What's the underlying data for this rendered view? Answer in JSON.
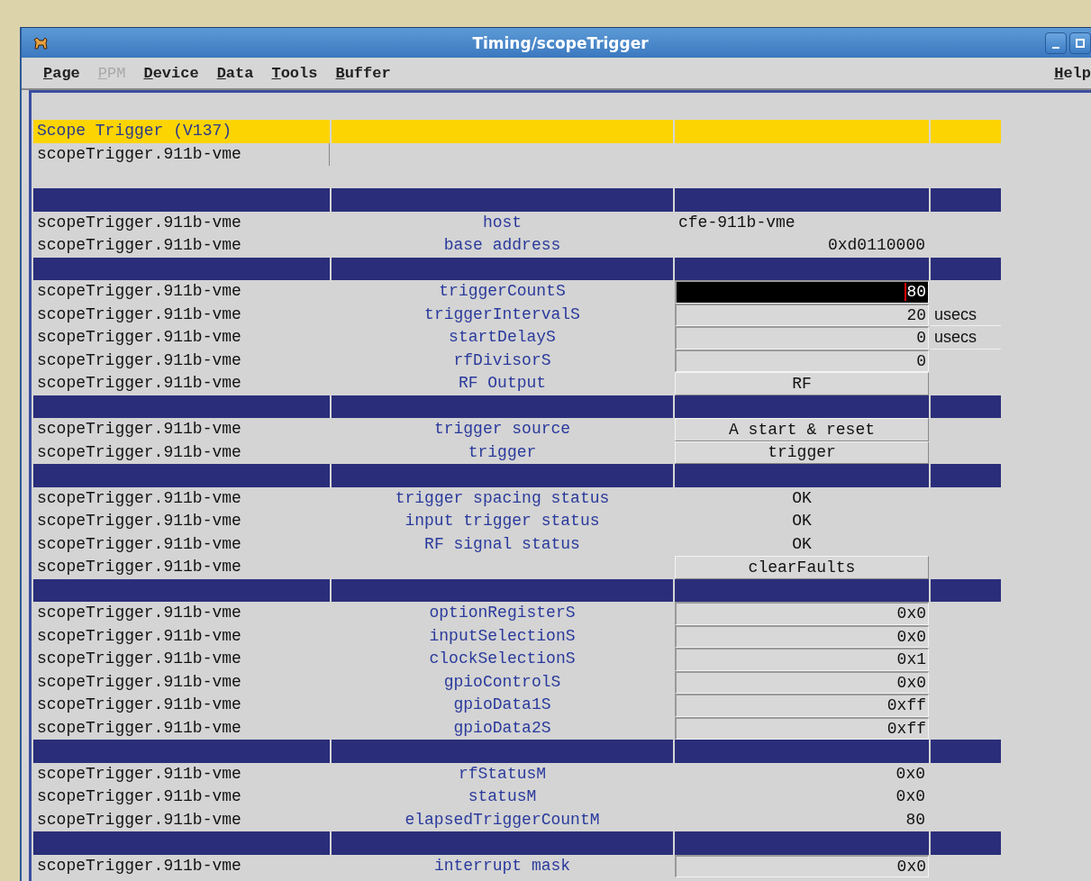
{
  "window": {
    "title": "Timing/scopeTrigger"
  },
  "menu": [
    {
      "label": "Page",
      "disabled": false
    },
    {
      "label": "PPM",
      "disabled": true
    },
    {
      "label": "Device",
      "disabled": false
    },
    {
      "label": "Data",
      "disabled": false
    },
    {
      "label": "Tools",
      "disabled": false
    },
    {
      "label": "Buffer",
      "disabled": false
    }
  ],
  "help_menu": {
    "label": "Help",
    "disabled": false
  },
  "header": {
    "title": "Scope Trigger (V137)",
    "device": "scopeTrigger.911b-vme"
  },
  "sections": [
    {
      "rows": [
        {
          "device": "scopeTrigger.911b-vme",
          "property": "host",
          "kind": "text-left",
          "value": "cfe-911b-vme"
        },
        {
          "device": "scopeTrigger.911b-vme",
          "property": "base address",
          "kind": "text-right",
          "value": "0xd0110000"
        }
      ]
    },
    {
      "rows": [
        {
          "device": "scopeTrigger.911b-vme",
          "property": "triggerCountS",
          "kind": "field",
          "value": "80",
          "focused": true
        },
        {
          "device": "scopeTrigger.911b-vme",
          "property": "triggerIntervalS",
          "kind": "field",
          "value": "20",
          "focused": false,
          "unit": "usecs"
        },
        {
          "device": "scopeTrigger.911b-vme",
          "property": "startDelayS",
          "kind": "field",
          "value": "0",
          "focused": false,
          "unit": "usecs"
        },
        {
          "device": "scopeTrigger.911b-vme",
          "property": "rfDivisorS",
          "kind": "field",
          "value": "0",
          "focused": false
        },
        {
          "device": "scopeTrigger.911b-vme",
          "property": "RF Output",
          "kind": "button",
          "value": "RF"
        }
      ]
    },
    {
      "rows": [
        {
          "device": "scopeTrigger.911b-vme",
          "property": "trigger source",
          "kind": "button",
          "value": "A start & reset"
        },
        {
          "device": "scopeTrigger.911b-vme",
          "property": "trigger",
          "kind": "button",
          "value": "trigger"
        }
      ]
    },
    {
      "rows": [
        {
          "device": "scopeTrigger.911b-vme",
          "property": "trigger spacing status",
          "kind": "status",
          "value": "OK"
        },
        {
          "device": "scopeTrigger.911b-vme",
          "property": "input trigger status",
          "kind": "status",
          "value": "OK"
        },
        {
          "device": "scopeTrigger.911b-vme",
          "property": "RF signal status",
          "kind": "status",
          "value": "OK"
        },
        {
          "device": "scopeTrigger.911b-vme",
          "kind": "button",
          "value": "clearFaults"
        }
      ]
    },
    {
      "rows": [
        {
          "device": "scopeTrigger.911b-vme",
          "property": "optionRegisterS",
          "kind": "field",
          "value": "0x0",
          "focused": false
        },
        {
          "device": "scopeTrigger.911b-vme",
          "property": "inputSelectionS",
          "kind": "field",
          "value": "0x0",
          "focused": false
        },
        {
          "device": "scopeTrigger.911b-vme",
          "property": "clockSelectionS",
          "kind": "field",
          "value": "0x1",
          "focused": false
        },
        {
          "device": "scopeTrigger.911b-vme",
          "property": "gpioControlS",
          "kind": "field",
          "value": "0x0",
          "focused": false
        },
        {
          "device": "scopeTrigger.911b-vme",
          "property": "gpioData1S",
          "kind": "field",
          "value": "0xff",
          "focused": false
        },
        {
          "device": "scopeTrigger.911b-vme",
          "property": "gpioData2S",
          "kind": "field",
          "value": "0xff",
          "focused": false
        }
      ]
    },
    {
      "rows": [
        {
          "device": "scopeTrigger.911b-vme",
          "property": "rfStatusM",
          "kind": "text-right",
          "value": "0x0"
        },
        {
          "device": "scopeTrigger.911b-vme",
          "property": "statusM",
          "kind": "text-right",
          "value": "0x0"
        },
        {
          "device": "scopeTrigger.911b-vme",
          "property": "elapsedTriggerCountM",
          "kind": "text-right",
          "value": "80"
        }
      ]
    },
    {
      "rows": [
        {
          "device": "scopeTrigger.911b-vme",
          "property": "interrupt mask",
          "kind": "field",
          "value": "0x0",
          "focused": false
        }
      ]
    }
  ]
}
